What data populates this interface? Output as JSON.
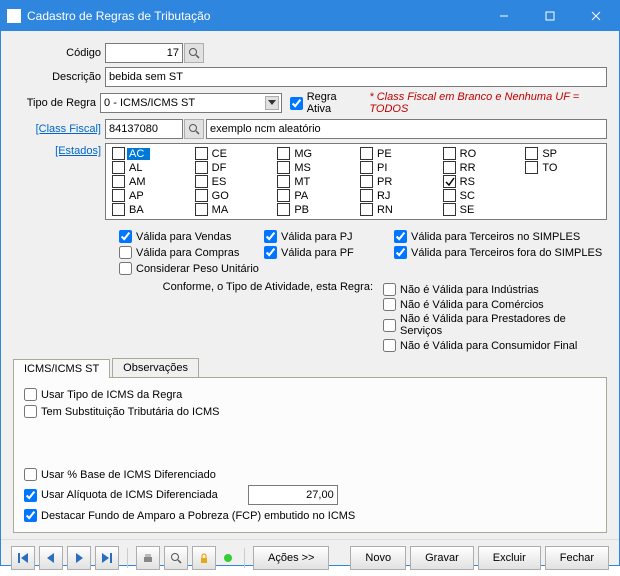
{
  "window": {
    "title": "Cadastro de Regras de Tributação"
  },
  "form": {
    "codigo_label": "Código",
    "codigo_value": "17",
    "descricao_label": "Descrição",
    "descricao_value": "bebida sem ST",
    "tipo_regra_label": "Tipo de Regra",
    "tipo_regra_value": "0 - ICMS/ICMS ST",
    "regra_ativa_label": "Regra Ativa",
    "warning": "* Class Fiscal em Branco e Nenhuma UF = TODOS",
    "class_fiscal_link": "[Class Fiscal]",
    "class_fiscal_value": "84137080",
    "class_fiscal_desc": "exemplo ncm aleatório",
    "estados_link": "[Estados]"
  },
  "states": [
    [
      "AC",
      "CE",
      "MG",
      "PE",
      "RO",
      "SP"
    ],
    [
      "AL",
      "DF",
      "MS",
      "PI",
      "RR",
      "TO"
    ],
    [
      "AM",
      "ES",
      "MT",
      "PR",
      "RS",
      ""
    ],
    [
      "AP",
      "GO",
      "PA",
      "RJ",
      "SC",
      ""
    ],
    [
      "BA",
      "MA",
      "PB",
      "RN",
      "SE",
      ""
    ]
  ],
  "states_checked": [
    "RS"
  ],
  "states_selected": "AC",
  "validity": {
    "vendas": "Válida para Vendas",
    "pj": "Válida para PJ",
    "terceiros_simples": "Válida para Terceiros no SIMPLES",
    "compras": "Válida para Compras",
    "pf": "Válida para PF",
    "terceiros_fora": "Válida para Terceiros fora do SIMPLES",
    "peso": "Considerar Peso Unitário"
  },
  "activity": {
    "label": "Conforme, o Tipo de Atividade, esta Regra:",
    "industrias": "Não é Válida para Indústrias",
    "comercios": "Não é Válida para Comércios",
    "prestadores": "Não é Válida para Prestadores de Serviços",
    "consumidor": "Não é Válida para Consumidor Final"
  },
  "tabs": {
    "icms": "ICMS/ICMS ST",
    "obs": "Observações"
  },
  "icms_tab": {
    "usar_tipo": "Usar Tipo de ICMS da Regra",
    "tem_st": "Tem Substituição Tributária do ICMS",
    "usar_pct_base": "Usar % Base de ICMS Diferenciado",
    "usar_aliq": "Usar Alíquota de ICMS Diferenciada",
    "aliq_value": "27,00",
    "destacar_fcp": "Destacar Fundo de Amparo a Pobreza (FCP) embutido no ICMS"
  },
  "buttons": {
    "acoes": "Ações >>",
    "novo": "Novo",
    "gravar": "Gravar",
    "excluir": "Excluir",
    "fechar": "Fechar"
  }
}
